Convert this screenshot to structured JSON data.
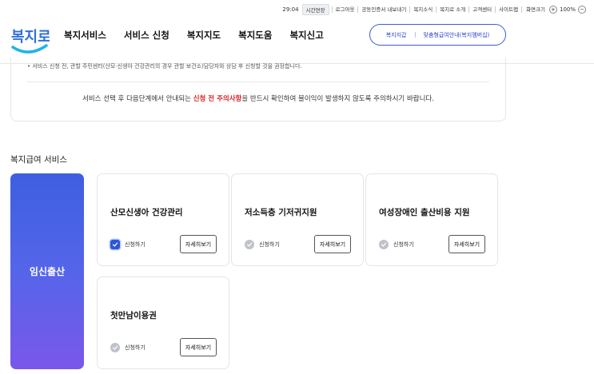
{
  "util_bar": {
    "timer": "29:04",
    "extend_label": "시간연장",
    "links": [
      "로그아웃",
      "공동인증서 내보내기",
      "복지소식",
      "복지로 소개",
      "고객센터",
      "사이트맵"
    ],
    "zoom_label": "화면크기",
    "zoom_plus": "+",
    "zoom_value": "100%",
    "zoom_minus": "−"
  },
  "header": {
    "logo_text": "복지로",
    "nav": [
      "복지서비스",
      "서비스 신청",
      "복지지도",
      "복지도움",
      "복지신고"
    ],
    "pill_left": "복지지갑",
    "pill_right": "맞춤형급여안내(복지멤버십)"
  },
  "notice": {
    "bullet": "• 서비스 신청 전, 관할 주민센터(산모·신생아 건강관리의 경우 관할 보건소)담당자와 상담 후 신청할 것을 권장합니다.",
    "main_before": "서비스 선택 후 다음단계에서 안내되는 ",
    "main_highlight": "신청 전 주의사항",
    "main_after": "을 반드시 확인하여 불이익이 발생하지 않도록 주의하시기 바랍니다."
  },
  "section": {
    "title": "복지급여 서비스",
    "category": "임신출산",
    "apply_label": "신청하기",
    "detail_label": "자세히보기",
    "services": [
      {
        "title": "산모신생아 건강관리",
        "checked": true
      },
      {
        "title": "저소득층 기저귀지원",
        "checked": false
      },
      {
        "title": "여성장애인 출산비용 지원",
        "checked": false
      },
      {
        "title": "첫만남이용권",
        "checked": false
      }
    ]
  },
  "colors": {
    "accent": "#2c56d8",
    "warning": "#d6262b",
    "category_gradient_top": "#3d5fe0",
    "category_gradient_bottom": "#7a57ea"
  }
}
